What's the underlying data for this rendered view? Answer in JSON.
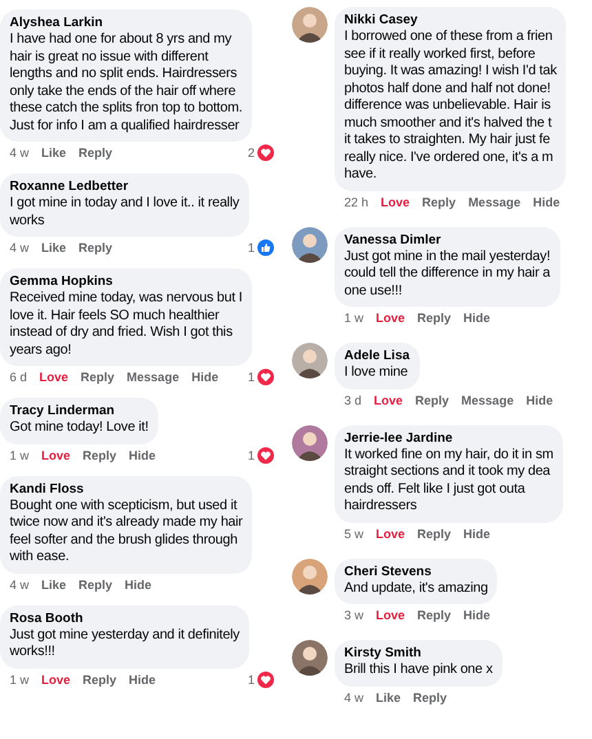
{
  "left_column": [
    {
      "author": "Alyshea Larkin",
      "lines": [
        "I have had one for about 8 yrs and my",
        "hair is great no issue with different",
        "lengths and no split ends. Hairdressers",
        "only take the ends of the hair off where",
        "these catch the splits fron top to bottom.",
        "Just for info I am a qualified hairdresser"
      ],
      "time": "4 w",
      "reaction_button": {
        "label": "Like",
        "selected": false
      },
      "actions": [
        "Reply"
      ],
      "reaction": {
        "count": "2",
        "kind": "love"
      }
    },
    {
      "author": "Roxanne Ledbetter",
      "lines": [
        "I got mine in today and I love it.. it really",
        "works"
      ],
      "time": "4 w",
      "reaction_button": {
        "label": "Like",
        "selected": false
      },
      "actions": [
        "Reply"
      ],
      "reaction": {
        "count": "1",
        "kind": "like"
      }
    },
    {
      "author": "Gemma Hopkins",
      "lines": [
        "Received mine today, was nervous but I",
        "love it. Hair feels SO much healthier",
        "instead of dry and fried. Wish I got this",
        "years ago!"
      ],
      "time": "6 d",
      "reaction_button": {
        "label": "Love",
        "selected": true
      },
      "actions": [
        "Reply",
        "Message",
        "Hide"
      ],
      "reaction": {
        "count": "1",
        "kind": "love"
      }
    },
    {
      "author": "Tracy Linderman",
      "lines": [
        "Got mine today! Love it!"
      ],
      "time": "1 w",
      "reaction_button": {
        "label": "Love",
        "selected": true
      },
      "actions": [
        "Reply",
        "Hide"
      ],
      "reaction": {
        "count": "1",
        "kind": "love"
      }
    },
    {
      "author": "Kandi Floss",
      "lines": [
        "Bought one with scepticism, but used it",
        "twice now and it's already made my hair",
        "feel softer and the brush glides through",
        "with ease."
      ],
      "time": "4 w",
      "reaction_button": {
        "label": "Like",
        "selected": false
      },
      "actions": [
        "Reply",
        "Hide"
      ]
    },
    {
      "author": "Rosa Booth",
      "lines": [
        "Just got mine yesterday and it definitely",
        "works!!!"
      ],
      "time": "1 w",
      "reaction_button": {
        "label": "Love",
        "selected": true
      },
      "actions": [
        "Reply",
        "Hide"
      ],
      "reaction": {
        "count": "1",
        "kind": "love"
      }
    }
  ],
  "right_column": [
    {
      "author": "Nikki Casey",
      "lines": [
        "I borrowed one of these from a frien",
        "see if it really worked first, before",
        "buying. It was amazing! I wish I'd tak",
        "photos half done and half not done!",
        "difference was unbelievable. Hair is",
        "much smoother and it's halved the t",
        "it takes to straighten. My hair just fe",
        "really nice. I've ordered one, it's a m",
        "have."
      ],
      "time": "22 h",
      "reaction_button": {
        "label": "Love",
        "selected": true
      },
      "actions": [
        "Reply",
        "Message",
        "Hide"
      ]
    },
    {
      "author": "Vanessa Dimler",
      "lines": [
        "Just got mine in the mail yesterday!",
        "could tell the difference in my hair a",
        "one use!!!"
      ],
      "time": "1 w",
      "reaction_button": {
        "label": "Love",
        "selected": true
      },
      "actions": [
        "Reply",
        "Hide"
      ]
    },
    {
      "author": "Adele Lisa",
      "lines": [
        "I love mine"
      ],
      "time": "3 d",
      "reaction_button": {
        "label": "Love",
        "selected": true
      },
      "actions": [
        "Reply",
        "Message",
        "Hide"
      ]
    },
    {
      "author": "Jerrie-lee Jardine",
      "lines": [
        "It worked fine on my hair, do it in sm",
        "straight sections and it took my dea",
        "ends off. Felt like I just got outa",
        "hairdressers"
      ],
      "time": "5 w",
      "reaction_button": {
        "label": "Love",
        "selected": true
      },
      "actions": [
        "Reply",
        "Hide"
      ]
    },
    {
      "author": "Cheri Stevens",
      "lines": [
        "And update, it's amazing"
      ],
      "time": "3 w",
      "reaction_button": {
        "label": "Love",
        "selected": true
      },
      "actions": [
        "Reply",
        "Hide"
      ]
    },
    {
      "author": "Kirsty Smith",
      "lines": [
        "Brill this I have pink one x"
      ],
      "time": "4 w",
      "reaction_button": {
        "label": "Like",
        "selected": false
      },
      "actions": [
        "Reply"
      ]
    }
  ]
}
